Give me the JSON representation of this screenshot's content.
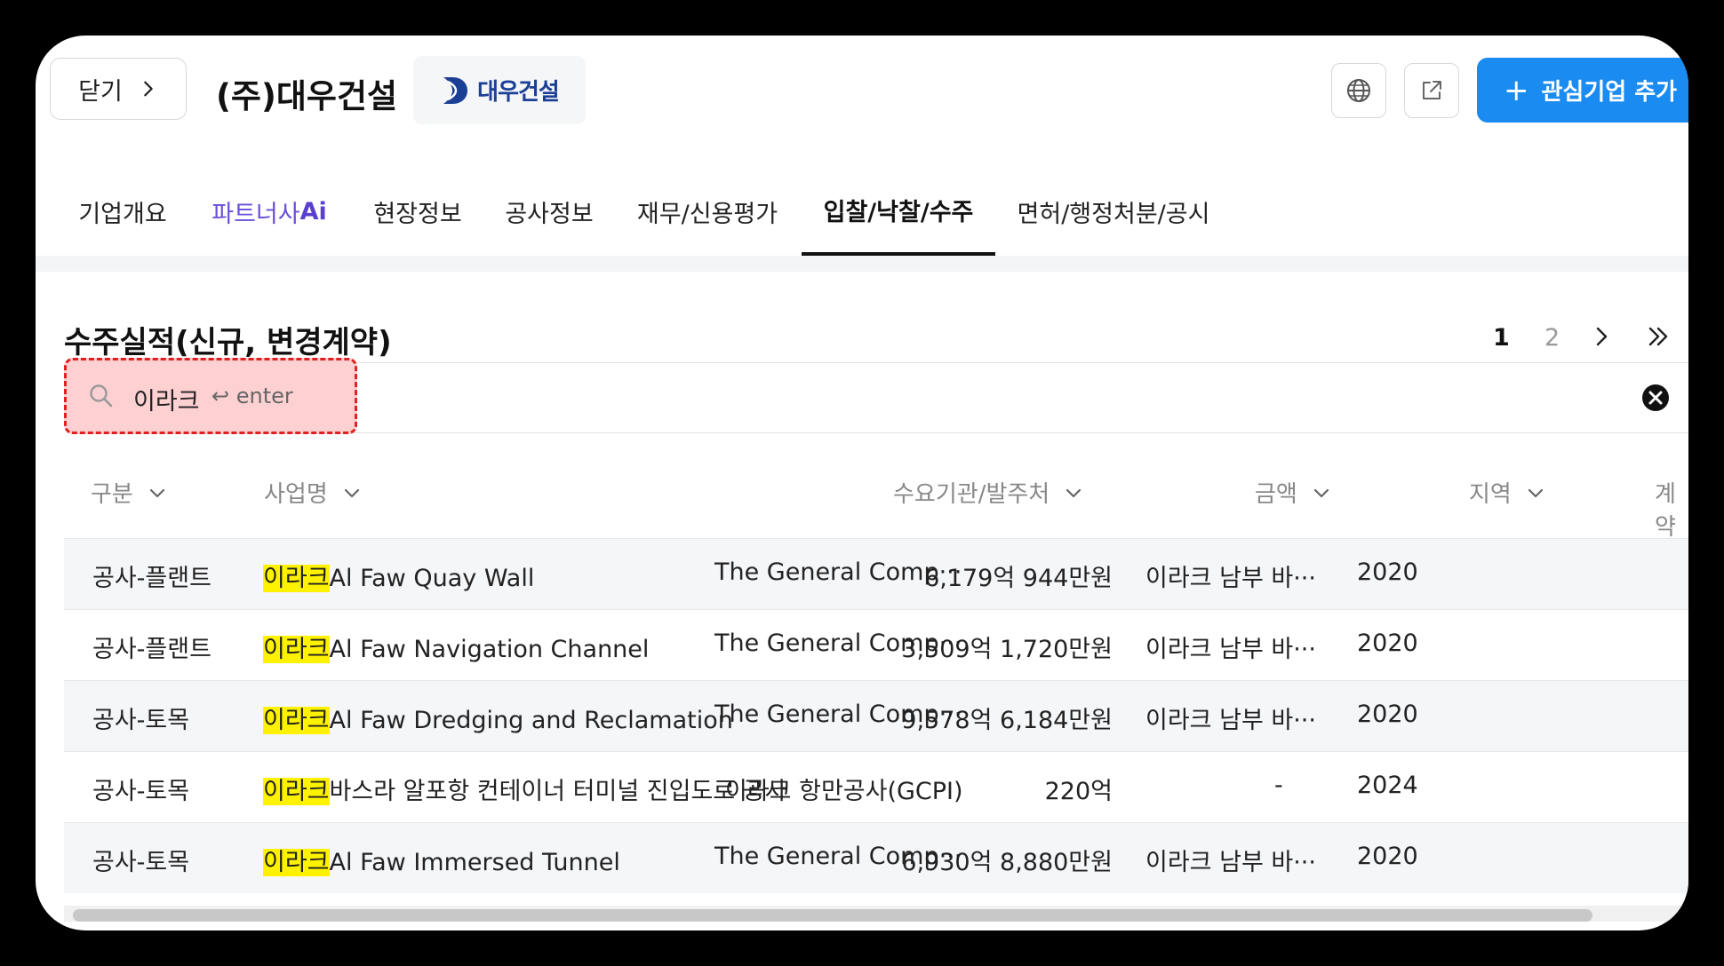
{
  "header": {
    "close_label": "닫기",
    "company_name": "(주)대우건설",
    "logo_text": "대우건설",
    "add_button_label": "관심기업 추가"
  },
  "tabs": [
    {
      "label": "기업개요"
    },
    {
      "label_prefix": "파트너사",
      "label_suffix": "Ai"
    },
    {
      "label": "현장정보"
    },
    {
      "label": "공사정보"
    },
    {
      "label": "재무/신용평가"
    },
    {
      "label": "입찰/낙찰/수주"
    },
    {
      "label": "면허/행정처분/공시"
    }
  ],
  "section": {
    "title": "수주실적(신규, 변경계약)",
    "pagination": {
      "current": "1",
      "next_page": "2"
    }
  },
  "search": {
    "value": "이라크",
    "hint": "↩ enter"
  },
  "table": {
    "columns": [
      "구분",
      "사업명",
      "수요기관/발주처",
      "금액",
      "지역",
      "계약"
    ],
    "rows": [
      {
        "type": "공사-플랜트",
        "highlight": "이라크",
        "name": "Al Faw Quay Wall",
        "client": "The General Comp···",
        "amount": "6,179억 944만원",
        "region": "이라크 남부 바···",
        "date": "2020"
      },
      {
        "type": "공사-플랜트",
        "highlight": "이라크",
        "name": "Al Faw Navigation Channel",
        "client": "The General Comp···",
        "amount": "3,509억 1,720만원",
        "region": "이라크 남부 바···",
        "date": "2020"
      },
      {
        "type": "공사-토목",
        "highlight": "이라크",
        "name": "Al Faw Dredging and Reclamation",
        "client": "The General Comp···",
        "amount": "9,578억 6,184만원",
        "region": "이라크 남부 바···",
        "date": "2020"
      },
      {
        "type": "공사-토목",
        "highlight": "이라크",
        "name": "바스라 알포항 컨테이너 터미널 진입도로 공사",
        "client": "이라크 항만공사(GCPI)",
        "amount": "220억",
        "region": "-",
        "date": "2024"
      },
      {
        "type": "공사-토목",
        "highlight": "이라크",
        "name": "Al Faw Immersed Tunnel",
        "client": "The General Comp···",
        "amount": "6,930억 8,880만원",
        "region": "이라크 남부 바···",
        "date": "2020"
      }
    ]
  }
}
